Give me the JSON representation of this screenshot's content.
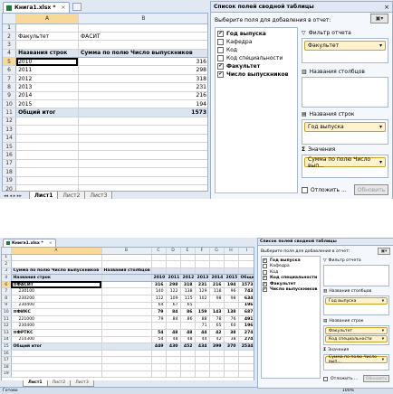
{
  "top": {
    "tab_title": "Книга1.xlsx *",
    "name_box": "A5",
    "col_headers": [
      "A",
      "B"
    ],
    "rows": [
      {
        "n": "1",
        "a": "",
        "b": ""
      },
      {
        "n": "2",
        "a": "Факультет",
        "b": "ФАСИТ"
      },
      {
        "n": "3",
        "a": "",
        "b": ""
      },
      {
        "n": "4",
        "a": "Названия строк",
        "b": "Сумма по полю Число выпускников"
      },
      {
        "n": "5",
        "a": "2010",
        "b": "316"
      },
      {
        "n": "6",
        "a": "2011",
        "b": "298"
      },
      {
        "n": "7",
        "a": "2012",
        "b": "318"
      },
      {
        "n": "8",
        "a": "2013",
        "b": "231"
      },
      {
        "n": "9",
        "a": "2014",
        "b": "216"
      },
      {
        "n": "10",
        "a": "2015",
        "b": "194"
      },
      {
        "n": "11",
        "a": "Общий итог",
        "b": "1573"
      },
      {
        "n": "12",
        "a": "",
        "b": ""
      },
      {
        "n": "13",
        "a": "",
        "b": ""
      },
      {
        "n": "14",
        "a": "",
        "b": ""
      },
      {
        "n": "15",
        "a": "",
        "b": ""
      },
      {
        "n": "16",
        "a": "",
        "b": ""
      },
      {
        "n": "17",
        "a": "",
        "b": ""
      },
      {
        "n": "18",
        "a": "",
        "b": ""
      },
      {
        "n": "19",
        "a": "",
        "b": ""
      },
      {
        "n": "20",
        "a": "",
        "b": ""
      }
    ],
    "sheet_tabs": [
      "Лист1",
      "Лист2",
      "Лист3"
    ],
    "panel": {
      "title": "Список полей сводной таблицы",
      "choose_label": "Выберите поля для добавления в отчет:",
      "fields": [
        {
          "label": "Год выпуска",
          "checked": true
        },
        {
          "label": "Кафедра",
          "checked": false
        },
        {
          "label": "Код",
          "checked": false
        },
        {
          "label": "Код специальности",
          "checked": false
        },
        {
          "label": "Факультет",
          "checked": true
        },
        {
          "label": "Число выпускников",
          "checked": true
        }
      ],
      "filter_label": "Фильтр отчета",
      "filter_item": "Факультет",
      "columns_label": "Названия столбцов",
      "rows_label": "Названия строк",
      "rows_item": "Год выпуска",
      "values_label": "Значения",
      "values_item": "Сумма по полю Число вып...",
      "defer_label": "Отложить ...",
      "update_label": "Обновить"
    }
  },
  "bottom": {
    "tab_title": "Книга1.xlsx *",
    "name_box": "A6",
    "col_headers": [
      "A",
      "B",
      "C",
      "D",
      "E",
      "F",
      "G",
      "H",
      "I"
    ],
    "header_row": {
      "a": "Сумма по полю Число выпускников",
      "b": "Названия столбцов"
    },
    "label_row": {
      "a": "Названия строк",
      "years": [
        "2010",
        "2011",
        "2012",
        "2013",
        "2014",
        "2015"
      ],
      "total": "Общий итог"
    },
    "data_rows": [
      {
        "n": "6",
        "label": "ФАСИТ",
        "vals": [
          "316",
          "298",
          "318",
          "231",
          "216",
          "194"
        ],
        "total": "1573",
        "group": true
      },
      {
        "n": "7",
        "label": "230100",
        "vals": [
          "140",
          "122",
          "138",
          "129",
          "118",
          "96"
        ],
        "total": "743",
        "group": false
      },
      {
        "n": "8",
        "label": "230200",
        "vals": [
          "112",
          "109",
          "115",
          "102",
          "98",
          "98"
        ],
        "total": "634",
        "group": false
      },
      {
        "n": "9",
        "label": "230400",
        "vals": [
          "64",
          "67",
          "65",
          "",
          "",
          ""
        ],
        "total": "196",
        "group": false
      },
      {
        "n": "10",
        "label": "ФИКС",
        "vals": [
          "79",
          "84",
          "86",
          "159",
          "143",
          "138"
        ],
        "total": "687",
        "group": true
      },
      {
        "n": "11",
        "label": "221000",
        "vals": [
          "79",
          "84",
          "86",
          "88",
          "78",
          "76"
        ],
        "total": "491",
        "group": false
      },
      {
        "n": "12",
        "label": "230400",
        "vals": [
          "",
          "",
          "",
          "71",
          "65",
          "60"
        ],
        "total": "196",
        "group": false
      },
      {
        "n": "13",
        "label": "ФРТКС",
        "vals": [
          "54",
          "48",
          "48",
          "44",
          "42",
          "38"
        ],
        "total": "274",
        "group": true
      },
      {
        "n": "14",
        "label": "210300",
        "vals": [
          "54",
          "48",
          "48",
          "44",
          "42",
          "38"
        ],
        "total": "274",
        "group": false
      },
      {
        "n": "15",
        "label": "Общий итог",
        "vals": [
          "449",
          "430",
          "452",
          "434",
          "399",
          "370"
        ],
        "total": "2534",
        "group": true
      }
    ],
    "sheet_tabs": [
      "Лист1",
      "Лист2",
      "Лист3"
    ],
    "status": "Готово",
    "zoom": "100%",
    "panel": {
      "title": "Список полей сводной таблицы",
      "choose_label": "Выберите поля для добавления в отчет:",
      "fields": [
        {
          "label": "Год выпуска",
          "checked": true
        },
        {
          "label": "Кафедра",
          "checked": false
        },
        {
          "label": "Код",
          "checked": false
        },
        {
          "label": "Код специальности",
          "checked": true
        },
        {
          "label": "Факультет",
          "checked": true
        },
        {
          "label": "Число выпускников",
          "checked": true
        }
      ],
      "filter_label": "Фильтр отчета",
      "columns_label": "Названия столбцов",
      "columns_item": "Год выпуска",
      "rows_label": "Названия строк",
      "rows_items": [
        "Факультет",
        "Код специальности"
      ],
      "values_label": "Значения",
      "values_item": "Сумма по полю Число вып...",
      "defer_label": "Отложить ...",
      "update_label": "Обновить"
    }
  }
}
